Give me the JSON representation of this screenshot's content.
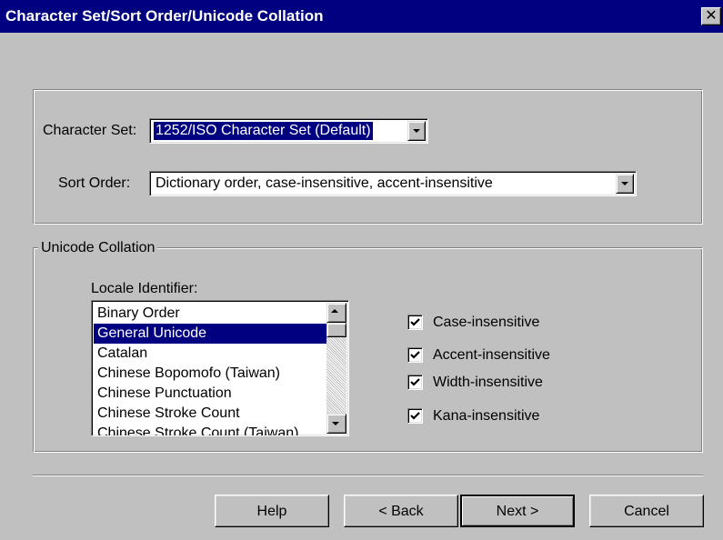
{
  "window": {
    "title": "Character Set/Sort Order/Unicode Collation",
    "close_glyph": "✕"
  },
  "settings": {
    "character_set_label": "Character Set:",
    "character_set_value": "1252/ISO Character Set (Default)",
    "sort_order_label": "Sort Order:",
    "sort_order_value": "Dictionary order, case-insensitive, accent-insensitive"
  },
  "unicode": {
    "group_title": "Unicode Collation",
    "locale_label": "Locale Identifier:",
    "locales": [
      "Binary Order",
      "General Unicode",
      "Catalan",
      "Chinese Bopomofo (Taiwan)",
      "Chinese Punctuation",
      "Chinese Stroke Count",
      "Chinese Stroke Count (Taiwan)"
    ],
    "selected_locale": "General Unicode",
    "options": [
      {
        "label": "Case-insensitive",
        "checked": true
      },
      {
        "label": "Accent-insensitive",
        "checked": true
      },
      {
        "label": "Width-insensitive",
        "checked": true
      },
      {
        "label": "Kana-insensitive",
        "checked": true
      }
    ]
  },
  "buttons": {
    "help": "Help",
    "back": "< Back",
    "next": "Next >",
    "cancel": "Cancel"
  },
  "icons": {
    "dropdown": "chevron-down-icon",
    "scroll_up": "arrow-up-icon",
    "scroll_down": "arrow-down-icon",
    "checkmark": "checkmark-icon",
    "close": "close-icon"
  },
  "colors": {
    "title_bar": "#000080",
    "face": "#c0c0c0",
    "selection": "#000080"
  }
}
